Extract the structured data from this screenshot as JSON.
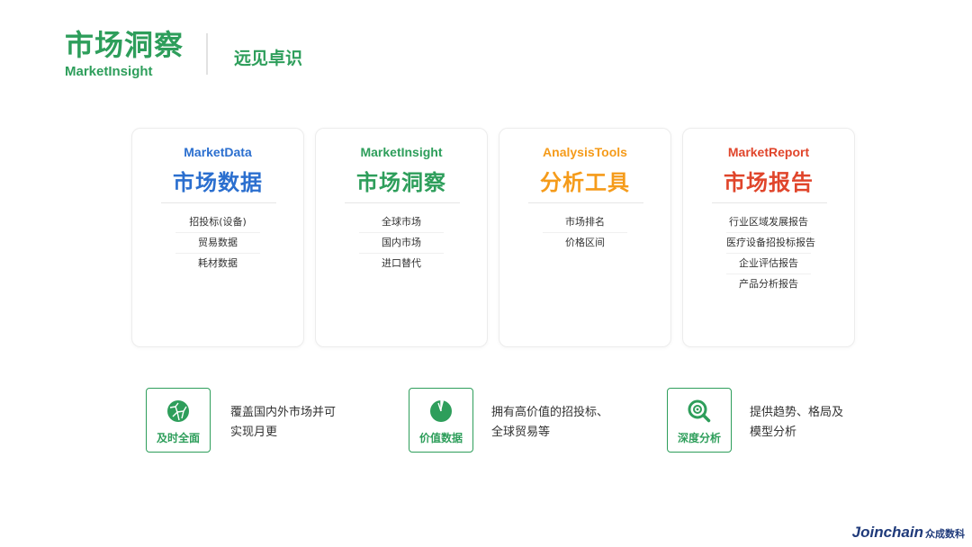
{
  "header": {
    "title": "市场洞察",
    "subtitle": "MarketInsight",
    "tag": "远见卓识"
  },
  "cards": [
    {
      "en": "MarketData",
      "cn": "市场数据",
      "color": "#2b6fcf",
      "items": [
        "招投标(设备)",
        "贸易数据",
        "耗材数据"
      ]
    },
    {
      "en": "MarketInsight",
      "cn": "市场洞察",
      "color": "#2e9e5b",
      "items": [
        "全球市场",
        "国内市场",
        "进口替代"
      ]
    },
    {
      "en": "AnalysisTools",
      "cn": "分析工具",
      "color": "#f59b1a",
      "items": [
        "市场排名",
        "价格区间"
      ]
    },
    {
      "en": "MarketReport",
      "cn": "市场报告",
      "color": "#e0452b",
      "items": [
        "行业区域发展报告",
        "医疗设备招投标报告",
        "企业评估报告",
        "产品分析报告"
      ]
    }
  ],
  "features": [
    {
      "icon": "globe-icon",
      "label": "及时全面",
      "text_line1": "覆盖国内外市场并可",
      "text_line2": "实现月更"
    },
    {
      "icon": "pie-chart-icon",
      "label": "价值数据",
      "text_line1": "拥有高价值的招投标、",
      "text_line2": "全球贸易等"
    },
    {
      "icon": "magnifier-icon",
      "label": "深度分析",
      "text_line1": "提供趋势、格局及",
      "text_line2": "模型分析"
    }
  ],
  "brand": {
    "en": "Joinchain",
    "cn": "众成数科"
  },
  "colors": {
    "accent": "#2e9e5b",
    "brand": "#1f3a7a"
  }
}
